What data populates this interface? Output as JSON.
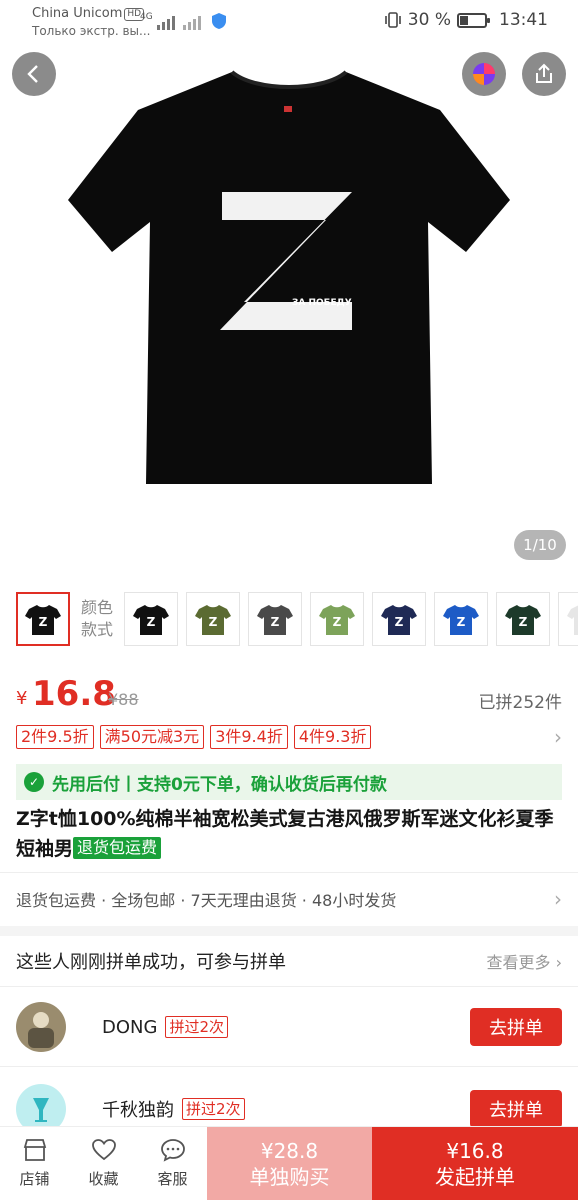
{
  "status_bar": {
    "carrier": "China Unicom",
    "hd": "HD",
    "subtitle": "Только экстр. вы...",
    "network": "4G",
    "battery_percent": "30 %",
    "battery_level": 0.3,
    "time": "13:41"
  },
  "hero": {
    "product_print_letter": "Z",
    "product_print_text": "ЗА ПОБЕДУ",
    "image_counter": "1/10"
  },
  "colors": {
    "label_line1": "颜色",
    "label_line2": "款式",
    "swatches": [
      {
        "name": "black",
        "hex": "#111111"
      },
      {
        "name": "black",
        "hex": "#111111"
      },
      {
        "name": "army-green",
        "hex": "#5b6b32"
      },
      {
        "name": "dark-gray",
        "hex": "#4a4a4a"
      },
      {
        "name": "light-green",
        "hex": "#7da35a"
      },
      {
        "name": "navy",
        "hex": "#1f2a55"
      },
      {
        "name": "royal-blue",
        "hex": "#1d5bc6"
      },
      {
        "name": "dark-green",
        "hex": "#1d3a2a"
      },
      {
        "name": "white",
        "hex": "#e6e6e6"
      }
    ]
  },
  "price": {
    "symbol": "¥",
    "value": "16.8",
    "original": "¥88",
    "sold": "已拼252件"
  },
  "discounts": [
    "2件9.5折",
    "满50元减3元",
    "3件9.4折",
    "4件9.3折"
  ],
  "pay_after": "先用后付丨支持0元下单，确认收货后再付款",
  "title": {
    "text": "Z字t恤100%纯棉半袖宽松美式复古港风俄罗斯军迷文化衫夏季短袖男",
    "badge": "退货包运费"
  },
  "service": "退货包运费 · 全场包邮 · 7天无理由退货 · 48小时发货",
  "group": {
    "header": "这些人刚刚拼单成功，可参与拼单",
    "more": "查看更多",
    "members": [
      {
        "name": "DONG",
        "tag": "拼过2次",
        "button": "去拼单"
      },
      {
        "name": "千秋独韵",
        "tag": "拼过2次",
        "button": "去拼单"
      }
    ]
  },
  "bottom_bar": {
    "store": "店铺",
    "favorite": "收藏",
    "service": "客服",
    "single_price": "¥28.8",
    "single_label": "单独购买",
    "group_price": "¥16.8",
    "group_label": "发起拼单"
  },
  "accent_color": "#e02e24"
}
